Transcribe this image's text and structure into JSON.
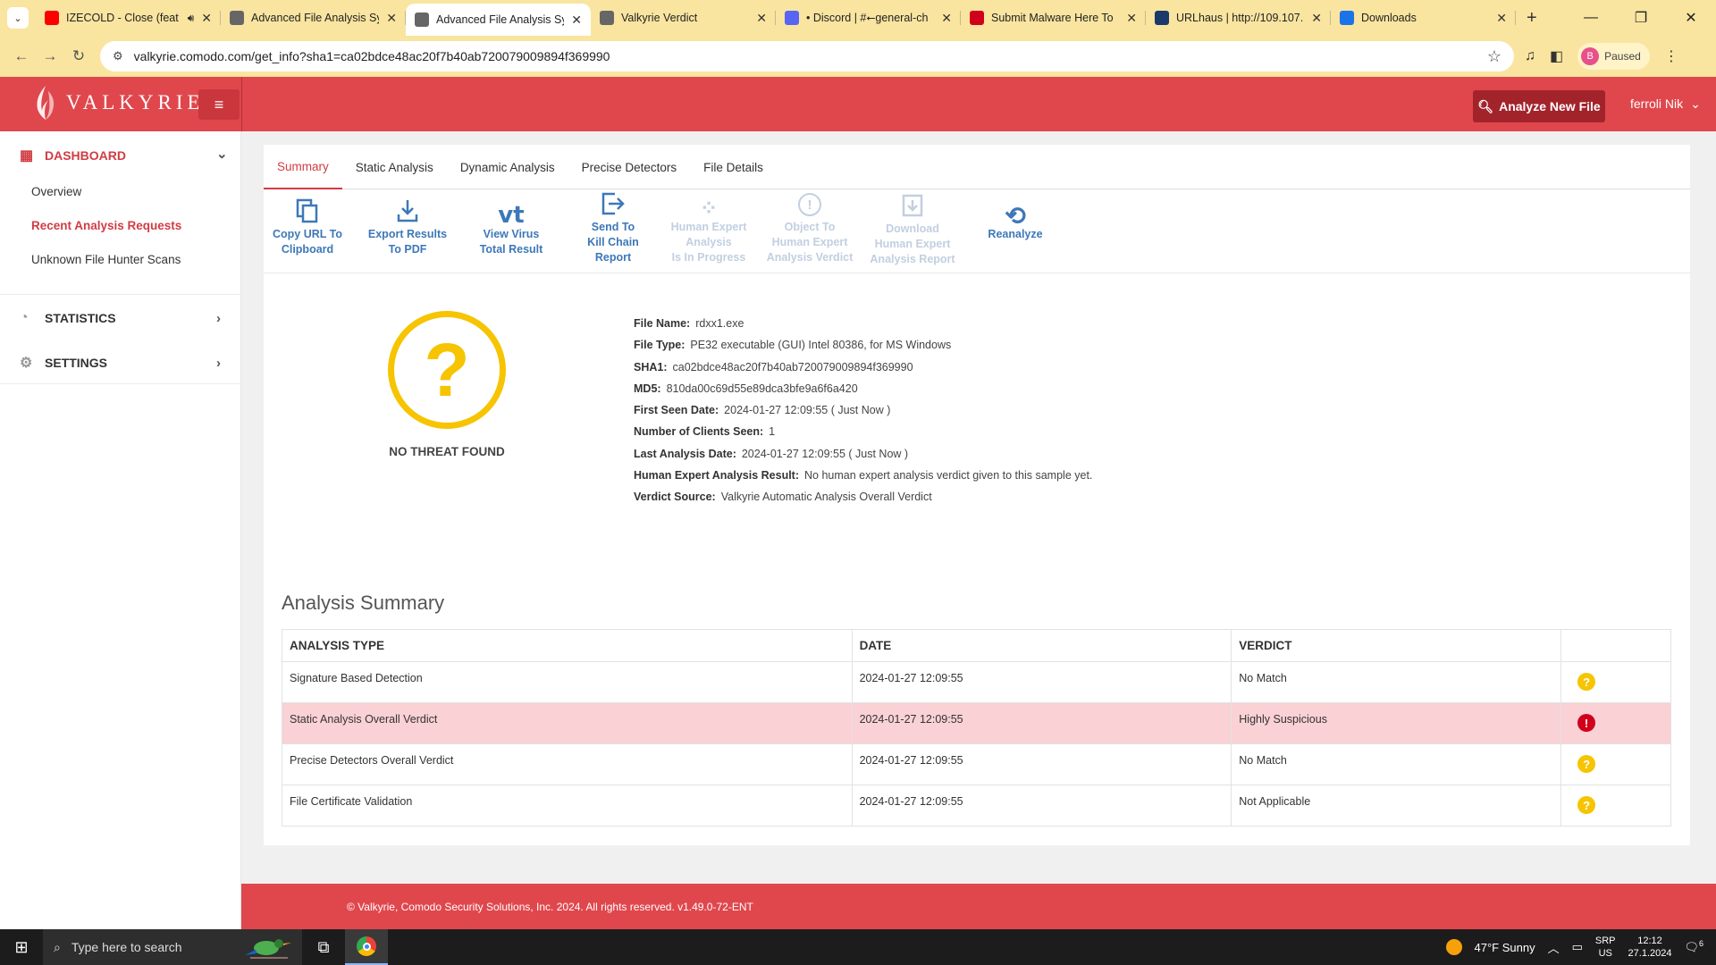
{
  "browser": {
    "tabs": [
      {
        "title": "IZECOLD - Close (feat",
        "favicon": "youtube-icon",
        "color": "#ff0000",
        "audio": true
      },
      {
        "title": "Advanced File Analysis Sy",
        "favicon": "valkyrie-icon",
        "color": "#666666"
      },
      {
        "title": "Advanced File Analysis Sy",
        "favicon": "valkyrie-icon",
        "color": "#666666",
        "active": true
      },
      {
        "title": "Valkyrie Verdict",
        "favicon": "valkyrie-icon",
        "color": "#666666"
      },
      {
        "title": "• Discord | #⭠general-ch",
        "favicon": "discord-icon",
        "color": "#5865f2"
      },
      {
        "title": "Submit Malware Here To",
        "favicon": "comodo-icon",
        "color": "#d0021b"
      },
      {
        "title": "URLhaus | http://109.107.",
        "favicon": "urlhaus-icon",
        "color": "#1a3a6b"
      },
      {
        "title": "Downloads",
        "favicon": "download-icon",
        "color": "#1a73e8"
      }
    ],
    "url": "valkyrie.comodo.com/get_info?sha1=ca02bdce48ac20f7b40ab720079009894f369990",
    "profile_initial": "B",
    "profile_status": "Paused"
  },
  "header": {
    "logo_text": "VALKYRIE",
    "analyze_button": "Analyze New File",
    "user_name": "ferroli Nik"
  },
  "sidebar": {
    "dashboard": "DASHBOARD",
    "items": [
      "Overview",
      "Recent Analysis Requests",
      "Unknown File Hunter Scans"
    ],
    "statistics": "STATISTICS",
    "settings": "SETTINGS"
  },
  "tabs": [
    "Summary",
    "Static Analysis",
    "Dynamic Analysis",
    "Precise Detectors",
    "File Details"
  ],
  "toolbar": [
    {
      "label": "Copy URL To\nClipboard",
      "icon": "copy-icon",
      "disabled": false
    },
    {
      "label": "Export Results\nTo PDF",
      "icon": "download-icon",
      "disabled": false
    },
    {
      "label": "View Virus\nTotal Result",
      "icon": "virustotal-icon",
      "disabled": false
    },
    {
      "label": "Send To\nKill Chain\nReport",
      "icon": "send-icon",
      "disabled": false
    },
    {
      "label": "Human Expert\nAnalysis\nIs In Progress",
      "icon": "spinner-icon",
      "disabled": true
    },
    {
      "label": "Object To\nHuman Expert\nAnalysis Verdict",
      "icon": "alert-icon",
      "disabled": true
    },
    {
      "label": "Download\nHuman Expert\nAnalysis Report",
      "icon": "download-report-icon",
      "disabled": true
    },
    {
      "label": "Reanalyze",
      "icon": "reanalyze-icon",
      "disabled": false
    }
  ],
  "verdict": {
    "label": "NO THREAT FOUND",
    "color": "#f6c400"
  },
  "file": {
    "name_label": "File Name:",
    "name": "rdxx1.exe",
    "type_label": "File Type:",
    "type": "PE32 executable (GUI) Intel 80386, for MS Windows",
    "sha1_label": "SHA1:",
    "sha1": "ca02bdce48ac20f7b40ab720079009894f369990",
    "md5_label": "MD5:",
    "md5": "810da00c69d55e89dca3bfe9a6f6a420",
    "first_seen_label": "First Seen Date:",
    "first_seen": "2024-01-27 12:09:55 ( Just Now )",
    "clients_label": "Number of Clients Seen:",
    "clients": "1",
    "last_analysis_label": "Last Analysis Date:",
    "last_analysis": "2024-01-27 12:09:55 ( Just Now )",
    "human_label": "Human Expert Analysis Result:",
    "human": "No human expert analysis verdict given to this sample yet.",
    "source_label": "Verdict Source:",
    "source": "Valkyrie Automatic Analysis Overall Verdict"
  },
  "analysis_summary": {
    "title": "Analysis Summary",
    "headers": [
      "ANALYSIS TYPE",
      "DATE",
      "VERDICT"
    ],
    "rows": [
      {
        "type": "Signature Based Detection",
        "date": "2024-01-27 12:09:55",
        "verdict": "No Match",
        "icon": "question-icon"
      },
      {
        "type": "Static Analysis Overall Verdict",
        "date": "2024-01-27 12:09:55",
        "verdict": "Highly Suspicious",
        "icon": "exclamation-icon"
      },
      {
        "type": "Precise Detectors Overall Verdict",
        "date": "2024-01-27 12:09:55",
        "verdict": "No Match",
        "icon": "question-icon"
      },
      {
        "type": "File Certificate Validation",
        "date": "2024-01-27 12:09:55",
        "verdict": "Not Applicable",
        "icon": "question-icon"
      }
    ]
  },
  "footer": "© Valkyrie, Comodo Security Solutions, Inc. 2024. All rights reserved. v1.49.0-72-ENT",
  "taskbar": {
    "search_placeholder": "Type here to search",
    "weather": "47°F  Sunny",
    "lang1": "SRP",
    "lang2": "US",
    "time": "12:12",
    "date": "27.1.2024",
    "notifications": "6"
  },
  "colors": {
    "brand_red": "#e0474d",
    "link_blue": "#3d78b8",
    "warning_yellow": "#f6c400",
    "danger_red": "#d0021b"
  }
}
